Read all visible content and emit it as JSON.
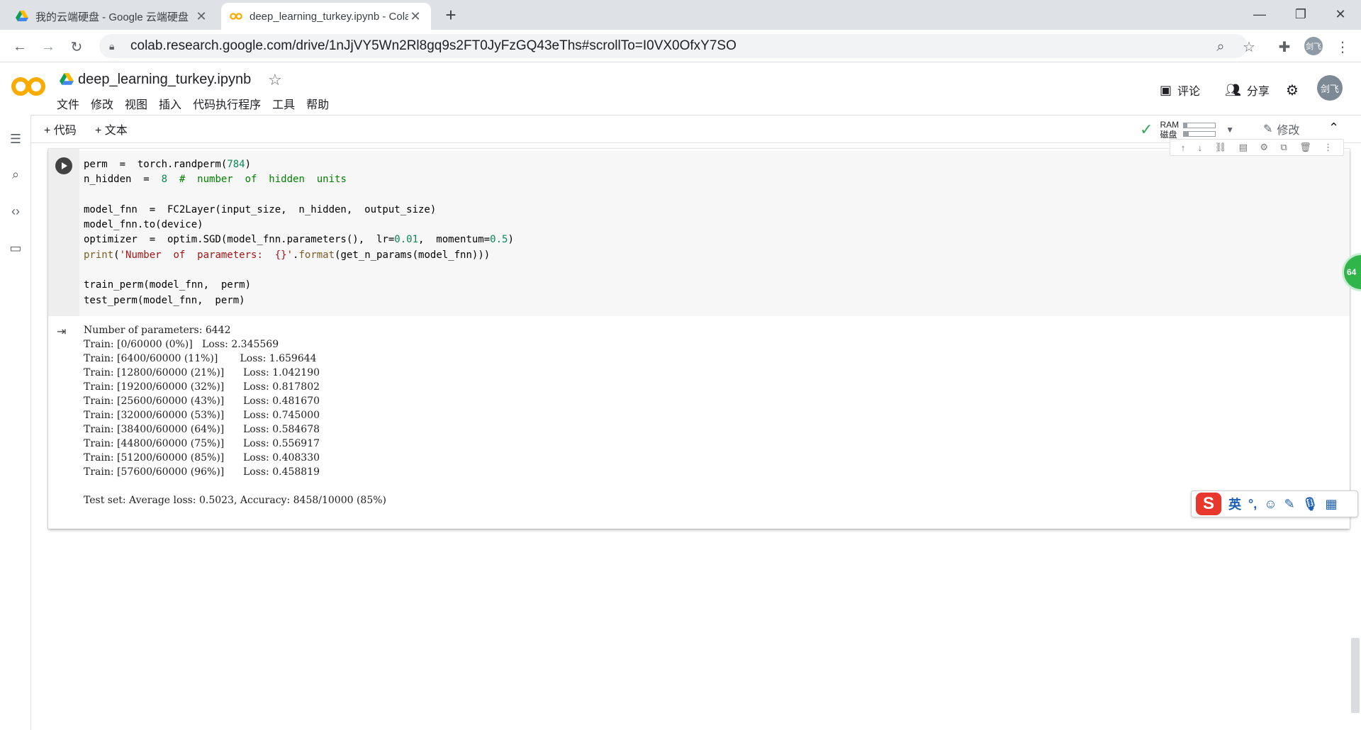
{
  "browser": {
    "tabs": [
      {
        "title": "我的云端硬盘 - Google 云端硬盘",
        "active": false,
        "favicon": "google-drive-icon"
      },
      {
        "title": "deep_learning_turkey.ipynb - Colaboratory",
        "active": true,
        "favicon": "colab-icon"
      }
    ],
    "new_tab": "+",
    "url": "colab.research.google.com/drive/1nJjVY5Wn2Rl8gq9s2FT0JyFzGQ43eThs#scrollTo=I0VX0OfxY7SO",
    "profile_initials": "剑飞"
  },
  "colab": {
    "notebook_title": "deep_learning_turkey.ipynb",
    "menu": [
      "文件",
      "修改",
      "视图",
      "插入",
      "代码执行程序",
      "工具",
      "帮助"
    ],
    "comment_label": "评论",
    "share_label": "分享",
    "avatar_initials": "剑飞",
    "add_code_label": "+ 代码",
    "add_text_label": "+ 文本",
    "ram_label": "RAM",
    "disk_label": "磁盘",
    "ram_usage_fraction": 0.1,
    "disk_usage_fraction": 0.15,
    "edit_label": "修改"
  },
  "cell": {
    "code_lines": [
      "perm  =  torch.randperm(784)",
      "n_hidden  =  8  #  number  of  hidden  units",
      "",
      "model_fnn  =  FC2Layer(input_size,  n_hidden,  output_size)",
      "model_fnn.to(device)",
      "optimizer  =  optim.SGD(model_fnn.parameters(),  lr=0.01,  momentum=0.5)",
      "print('Number  of  parameters:  {}'.format(get_n_params(model_fnn)))",
      "",
      "train_perm(model_fnn,  perm)",
      "test_perm(model_fnn,  perm)"
    ],
    "output_lines": [
      "Number of parameters: 6442",
      "Train: [0/60000 (0%)]   Loss: 2.345569",
      "Train: [6400/60000 (11%)]       Loss: 1.659644",
      "Train: [12800/60000 (21%)]      Loss: 1.042190",
      "Train: [19200/60000 (32%)]      Loss: 0.817802",
      "Train: [25600/60000 (43%)]      Loss: 0.481670",
      "Train: [32000/60000 (53%)]      Loss: 0.745000",
      "Train: [38400/60000 (64%)]      Loss: 0.584678",
      "Train: [44800/60000 (75%)]      Loss: 0.556917",
      "Train: [51200/60000 (85%)]      Loss: 0.408330",
      "Train: [57600/60000 (96%)]      Loss: 0.458819",
      "",
      "Test set: Average loss: 0.5023, Accuracy: 8458/10000 (85%)"
    ]
  },
  "ime": {
    "logo": "S",
    "lang": "英",
    "punct": "°,"
  },
  "floating_badge": "64"
}
